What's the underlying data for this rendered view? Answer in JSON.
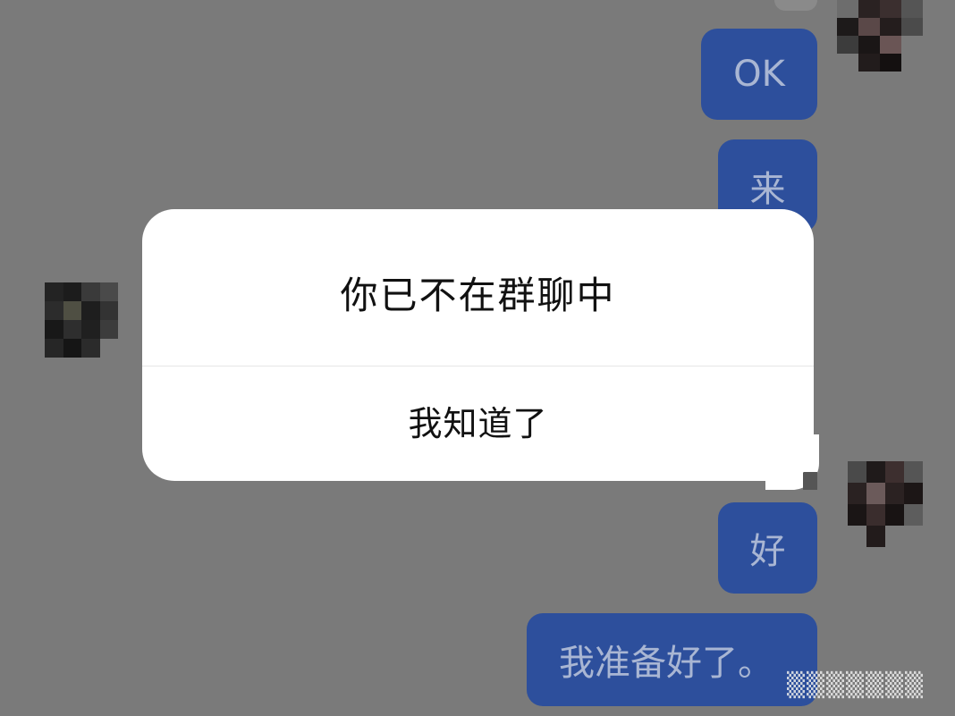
{
  "messages": [
    {
      "text": "OK",
      "side": "right"
    },
    {
      "text": "来",
      "side": "right"
    },
    {
      "text": "好",
      "side": "right"
    },
    {
      "text": "我准备好了。",
      "side": "right"
    }
  ],
  "alert": {
    "message": "你已不在群聊中",
    "confirm_label": "我知道了"
  },
  "colors": {
    "background": "#7a7a7a",
    "bubble_self": "#2d4f9c",
    "bubble_text": "#a9b6d3",
    "dialog_bg": "#ffffff",
    "dialog_text": "#111111"
  }
}
